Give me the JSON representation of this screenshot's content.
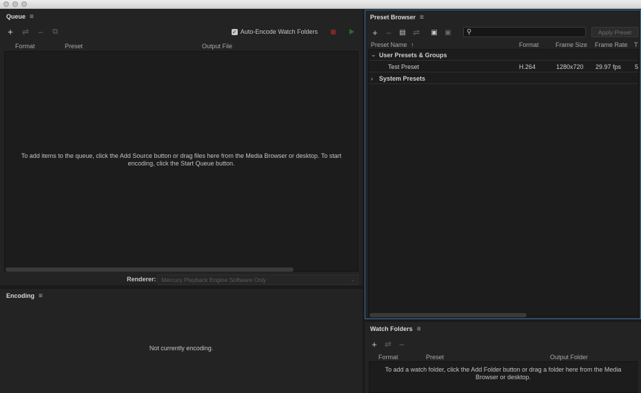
{
  "window": {
    "controls": [
      "close",
      "minimize",
      "zoom"
    ]
  },
  "queue": {
    "title": "Queue",
    "menu_icon": "hamburger-menu-icon",
    "toolbar": {
      "add": "+",
      "settings": "⇌",
      "remove": "–",
      "duplicate": "⧉"
    },
    "auto_encode_label": "Auto-Encode Watch Folders",
    "auto_encode_checked": true,
    "columns": [
      "Format",
      "Preset",
      "Output File"
    ],
    "empty_message": "To add items to the queue, click the Add Source button or drag files here from the Media Browser or desktop.  To start encoding, click the Start Queue button.",
    "renderer_label": "Renderer:",
    "renderer_value": "Mercury Playback Engine Software Only",
    "colors": {
      "stop": "#7a2a2a",
      "start": "#2f6b2f"
    }
  },
  "encoding": {
    "title": "Encoding",
    "status": "Not currently encoding."
  },
  "preset_browser": {
    "title": "Preset Browser",
    "search_placeholder": "",
    "apply_label": "Apply Preset",
    "columns": [
      "Preset Name",
      "Format",
      "Frame Size",
      "Frame Rate",
      "T"
    ],
    "groups": [
      {
        "name": "User Presets & Groups",
        "expanded": true,
        "presets": [
          {
            "name": "Test Preset",
            "format": "H.264",
            "frame_size": "1280x720",
            "frame_rate": "29.97 fps",
            "extra": "5"
          }
        ]
      },
      {
        "name": "System Presets",
        "expanded": false,
        "presets": []
      }
    ],
    "accent_color": "#3b6ea5"
  },
  "watch_folders": {
    "title": "Watch Folders",
    "columns": [
      "Format",
      "Preset",
      "Output Folder"
    ],
    "empty_message": "To add a watch folder, click the Add Folder button or drag a folder here from the Media Browser or desktop."
  }
}
